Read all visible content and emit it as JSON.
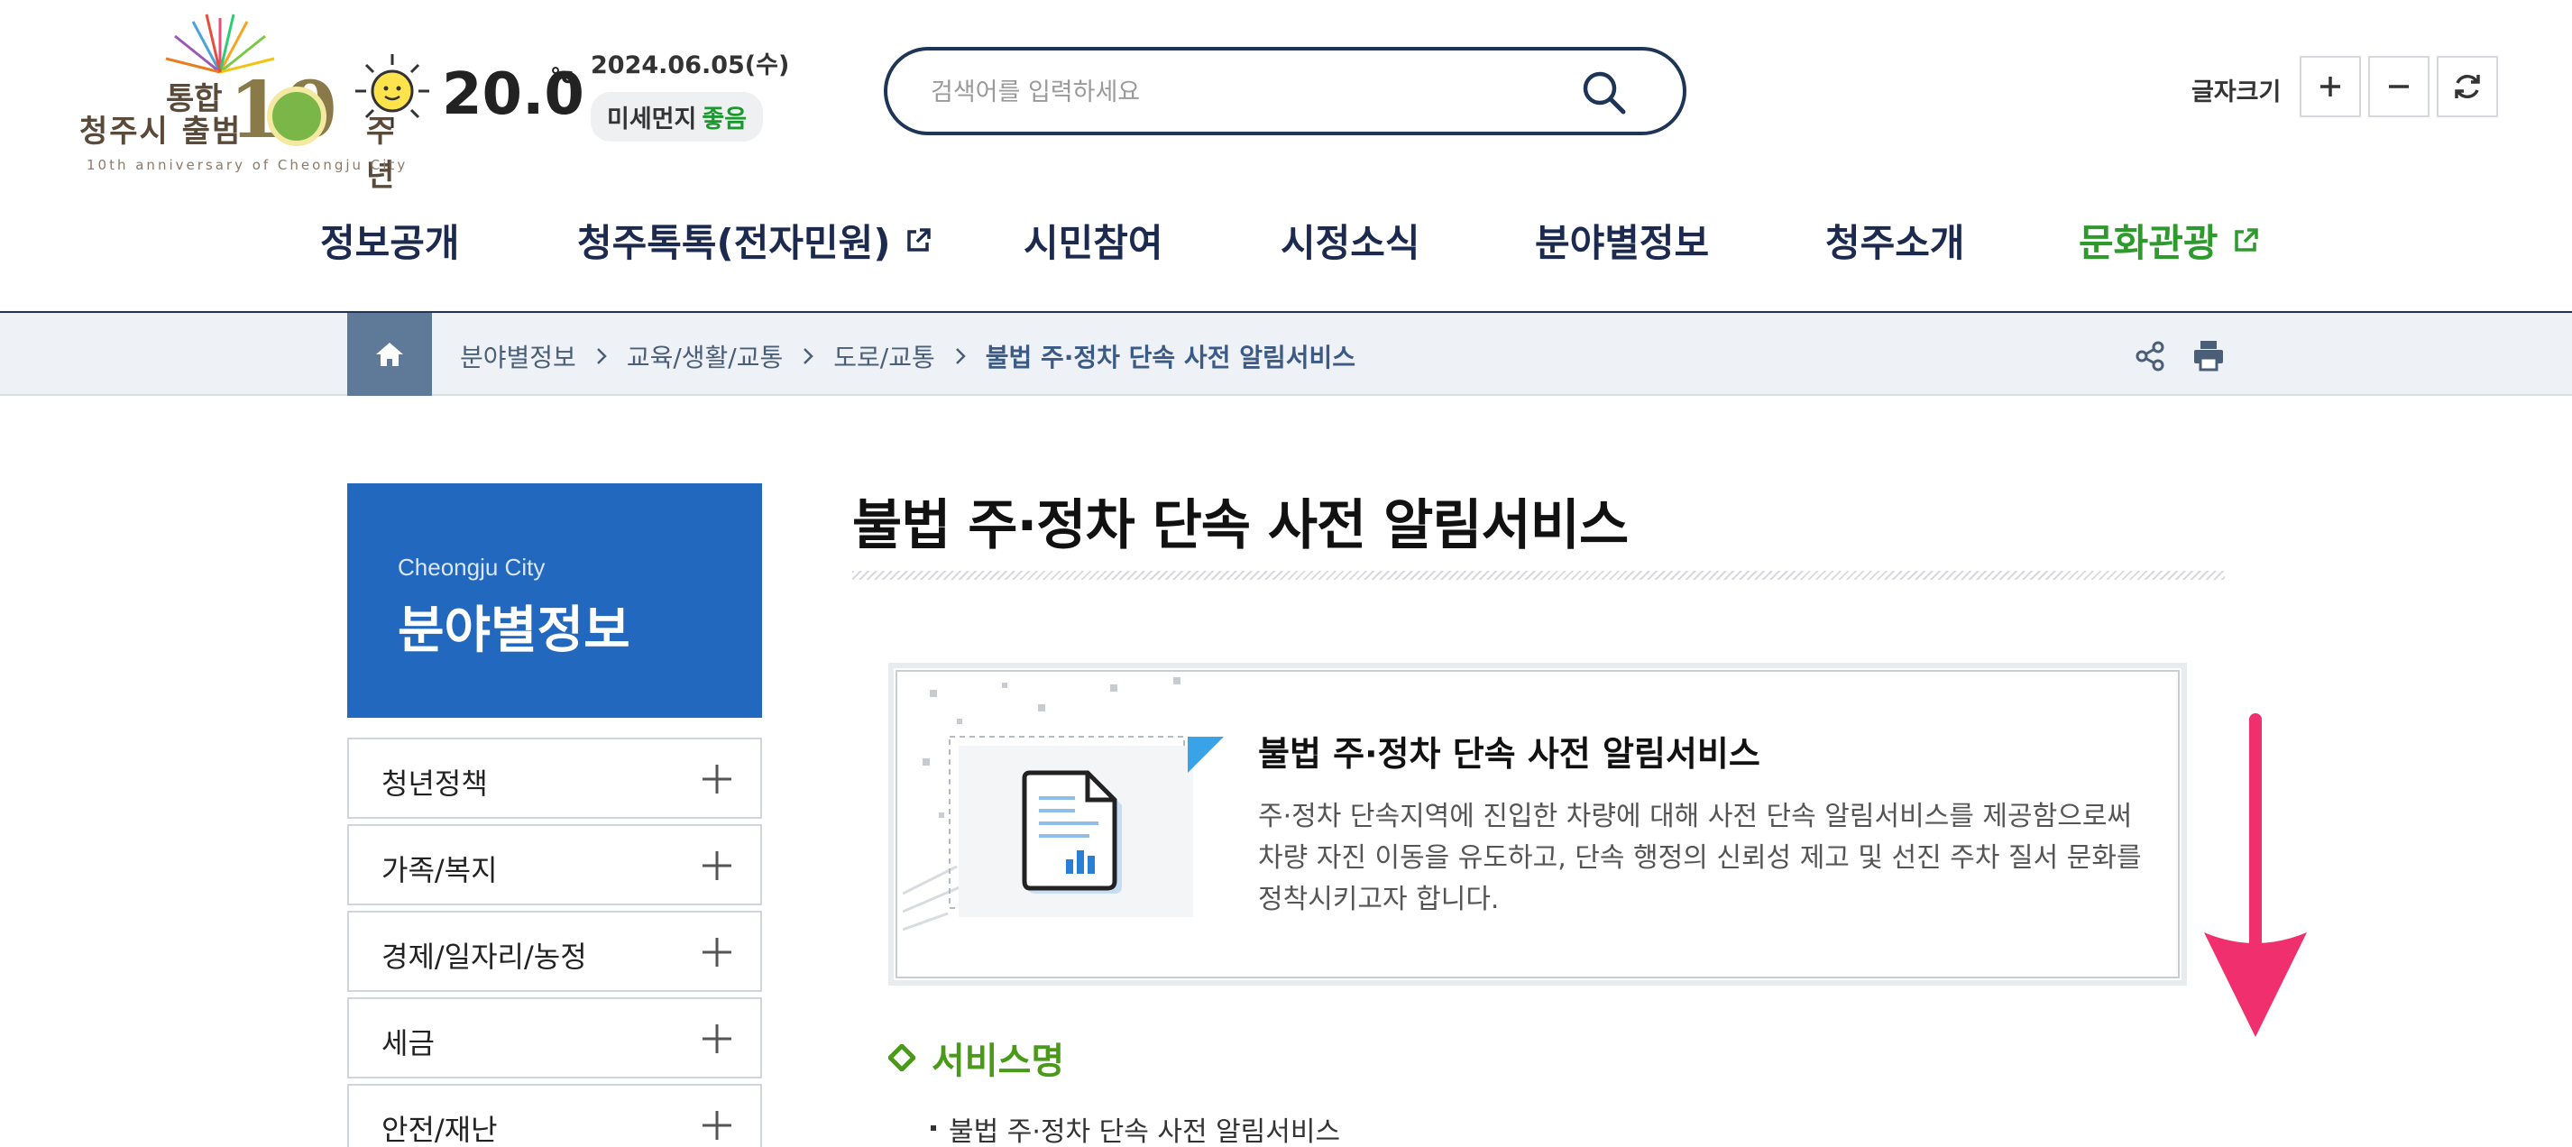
{
  "header": {
    "logo": {
      "line1": "통합",
      "line2": "청주시 출범",
      "ten": "10",
      "line3": "주년",
      "sub": "10th anniversary of Cheongju City"
    },
    "weather": {
      "temperature": "20.0",
      "unit": "°c",
      "date": "2024.06.05(수)",
      "dust_label": "미세먼지",
      "dust_status": "좋음",
      "icon": "sun-icon"
    },
    "search": {
      "placeholder": "검색어를 입력하세요",
      "value": ""
    },
    "font_size": {
      "label": "글자크기"
    }
  },
  "gnb": {
    "items": [
      {
        "label": "정보공개",
        "external": false
      },
      {
        "label": "청주톡톡(전자민원)",
        "external": true
      },
      {
        "label": "시민참여",
        "external": false
      },
      {
        "label": "시정소식",
        "external": false
      },
      {
        "label": "분야별정보",
        "external": false
      },
      {
        "label": "청주소개",
        "external": false
      },
      {
        "label": "문화관광",
        "external": true
      }
    ]
  },
  "breadcrumb": {
    "items": [
      "분야별정보",
      "교육/생활/교통",
      "도로/교통",
      "불법 주·정차 단속 사전 알림서비스"
    ]
  },
  "sidebar": {
    "subtitle": "Cheongju City",
    "title": "분야별정보",
    "items": [
      {
        "label": "청년정책"
      },
      {
        "label": "가족/복지"
      },
      {
        "label": "경제/일자리/농정"
      },
      {
        "label": "세금"
      },
      {
        "label": "안전/재난"
      }
    ]
  },
  "content": {
    "title": "불법 주·정차 단속 사전 알림서비스",
    "intro": {
      "heading": "불법 주·정차 단속 사전 알림서비스",
      "text": "주·정차 단속지역에 진입한 차량에 대해 사전 단속 알림서비스를 제공함으로써 차량 자진 이동을 유도하고, 단속 행정의 신뢰성 제고 및 선진 주차 질서 문화를 정착시키고자 합니다."
    },
    "section": {
      "title": "서비스명",
      "item": "불법 주·정차 단속 사전 알림서비스"
    }
  },
  "colors": {
    "navy": "#1d3557",
    "sidebar_blue": "#2168be",
    "green": "#2e9a2e",
    "section_green": "#4a9a1a",
    "arrow_pink": "#f0306e",
    "home_gray_blue": "#5f7a99"
  }
}
